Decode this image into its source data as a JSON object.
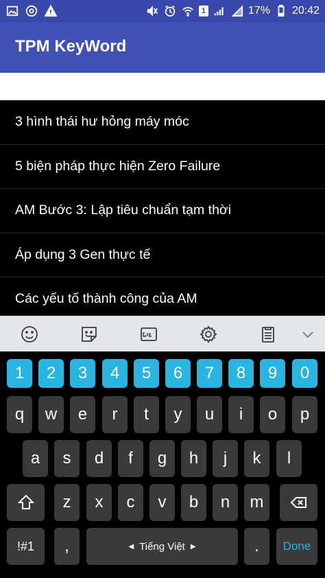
{
  "status_bar": {
    "battery_percent": "17%",
    "time": "20:42",
    "sim_label": "1"
  },
  "app_bar": {
    "title": "TPM KeyWord"
  },
  "keywords": [
    "3 hình thái hư hỏng máy móc",
    "5 biện pháp thực hiện Zero Failure",
    "AM Bước 3: Lập tiêu chuẩn tạm thời",
    "Áp dụng 3 Gen thực tế",
    "Các yếu tố thành công của AM"
  ],
  "keyboard": {
    "numbers": [
      "1",
      "2",
      "3",
      "4",
      "5",
      "6",
      "7",
      "8",
      "9",
      "0"
    ],
    "row1": [
      "q",
      "w",
      "e",
      "r",
      "t",
      "y",
      "u",
      "i",
      "o",
      "p"
    ],
    "row2": [
      "a",
      "s",
      "d",
      "f",
      "g",
      "h",
      "j",
      "k",
      "l"
    ],
    "row3": [
      "z",
      "x",
      "c",
      "v",
      "b",
      "n",
      "m"
    ],
    "symbols_label": "!#1",
    "comma_label": ",",
    "space_label": "Tiếng Việt",
    "period_label": ".",
    "done_label": "Done"
  },
  "colors": {
    "status_bar": "#3949ab",
    "app_bar": "#3f51b5",
    "number_key": "#29b4e2",
    "key": "#3a3a3a"
  }
}
